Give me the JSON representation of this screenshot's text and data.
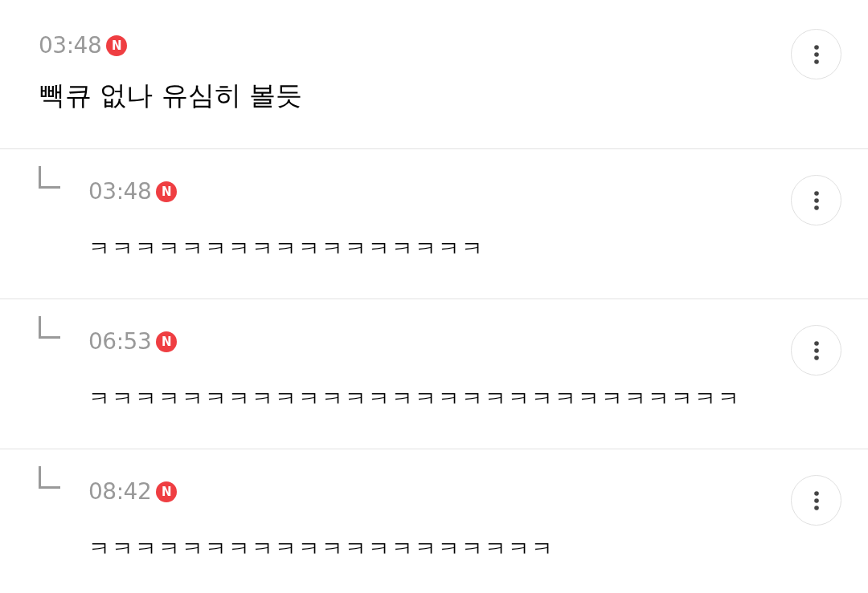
{
  "comments": [
    {
      "kind": "comment",
      "time": "03:48",
      "badge": "N",
      "text": "빽큐 없나 유심히 볼듯"
    },
    {
      "kind": "reply",
      "time": "03:48",
      "badge": "N",
      "text": "ㅋㅋㅋㅋㅋㅋㅋㅋㅋㅋㅋㅋㅋㅋㅋㅋㅋ"
    },
    {
      "kind": "reply",
      "time": "06:53",
      "badge": "N",
      "text": "ㅋㅋㅋㅋㅋㅋㅋㅋㅋㅋㅋㅋㅋㅋㅋㅋㅋㅋㅋㅋㅋㅋㅋㅋㅋㅋㅋㅋ"
    },
    {
      "kind": "reply",
      "time": "08:42",
      "badge": "N",
      "text": "ㅋㅋㅋㅋㅋㅋㅋㅋㅋㅋㅋㅋㅋㅋㅋㅋㅋㅋㅋㅋ"
    }
  ]
}
